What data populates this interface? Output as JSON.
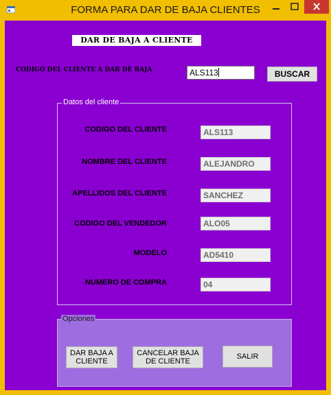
{
  "window": {
    "title": "FORMA PARA DAR DE BAJA CLIENTES",
    "controls": {
      "minimize": "▁",
      "maximize": "□",
      "close": "✕"
    }
  },
  "colors": {
    "form_background": "#8A00D1",
    "frame": "#F2BE00",
    "close": "#C7372F",
    "options_group": "#9E6EE0"
  },
  "heading": "DAR DE BAJA A CLIENTE",
  "search": {
    "label": "CODIGO DEL CLIENTE A DAR DE BAJA",
    "value": "ALS113",
    "button": "BUSCAR"
  },
  "client_data": {
    "legend": "Datos del cliente",
    "fields": [
      {
        "label": "CODIGO DEL CLIENTE",
        "value": "ALS113"
      },
      {
        "label": "NOMBRE DEL CLIENTE",
        "value": "ALEJANDRO"
      },
      {
        "label": "APELLIDOS DEL CLIENTE",
        "value": "SANCHEZ"
      },
      {
        "label": "CODIGO DEL VENDEDOR",
        "value": "ALO05"
      },
      {
        "label": "MODELO",
        "value": "AD5410"
      },
      {
        "label": "NUMERO DE COMPRA",
        "value": "04"
      }
    ]
  },
  "options": {
    "legend": "Opciones",
    "buttons": {
      "dar_baja_line1": "DAR BAJA A",
      "dar_baja_line2": "CLIENTE",
      "cancelar_line1": "CANCELAR BAJA",
      "cancelar_line2": "DE CLIENTE",
      "salir": "SALIR"
    }
  }
}
